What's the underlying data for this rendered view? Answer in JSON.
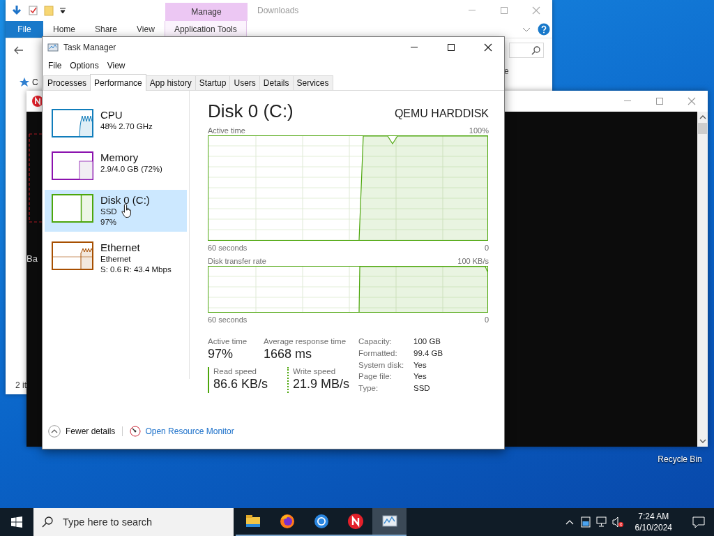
{
  "explorer": {
    "context_tab": "Manage",
    "title": "Downloads",
    "ribbon_tabs": [
      {
        "label": "File",
        "kind": "file"
      },
      {
        "label": "Home",
        "kind": "tab"
      },
      {
        "label": "Share",
        "kind": "tab"
      },
      {
        "label": "View",
        "kind": "tab"
      },
      {
        "label": "Application Tools",
        "kind": "context"
      }
    ],
    "nav_items": [
      "C"
    ],
    "cut_text": "e",
    "status_bar": "2 it"
  },
  "console_window": {
    "text": "Ba"
  },
  "task_manager": {
    "title": "Task Manager",
    "menu": [
      "File",
      "Options",
      "View"
    ],
    "tabs": [
      {
        "label": "Processes",
        "selected": false
      },
      {
        "label": "Performance",
        "selected": true
      },
      {
        "label": "App history",
        "selected": false
      },
      {
        "label": "Startup",
        "selected": false
      },
      {
        "label": "Users",
        "selected": false
      },
      {
        "label": "Details",
        "selected": false
      },
      {
        "label": "Services",
        "selected": false
      }
    ],
    "resources": [
      {
        "kind": "cpu",
        "name": "CPU",
        "details": [
          "48%  2.70 GHz"
        ],
        "color": "#117dbb",
        "selected": false
      },
      {
        "kind": "memory",
        "name": "Memory",
        "details": [
          "2.9/4.0 GB (72%)"
        ],
        "color": "#8b12ae",
        "selected": false
      },
      {
        "kind": "disk",
        "name": "Disk 0 (C:)",
        "details": [
          "SSD",
          "97%"
        ],
        "color": "#4da60c",
        "selected": true
      },
      {
        "kind": "network",
        "name": "Ethernet",
        "details": [
          "Ethernet",
          "S: 0.6 R: 43.4 Mbps"
        ],
        "color": "#a74f01",
        "selected": false
      }
    ],
    "detail": {
      "title": "Disk 0 (C:)",
      "model": "QEMU HARDDISK",
      "graphs": [
        {
          "kind": "active",
          "label": "Active time",
          "max": "100%",
          "span": "60 seconds",
          "min": "0"
        },
        {
          "kind": "transfer",
          "label": "Disk transfer rate",
          "max": "100 KB/s",
          "span": "60 seconds",
          "min": "0"
        }
      ],
      "stats": [
        {
          "label": "Active time",
          "value": "97%"
        },
        {
          "label": "Average response time",
          "value": "1668 ms"
        }
      ],
      "speeds": [
        {
          "kind": "read",
          "label": "Read speed",
          "value": "86.6 KB/s"
        },
        {
          "kind": "write",
          "label": "Write speed",
          "value": "21.9 MB/s"
        }
      ],
      "properties": [
        {
          "key": "Capacity:",
          "value": "100 GB"
        },
        {
          "key": "Formatted:",
          "value": "99.4 GB"
        },
        {
          "key": "System disk:",
          "value": "Yes"
        },
        {
          "key": "Page file:",
          "value": "Yes"
        },
        {
          "key": "Type:",
          "value": "SSD"
        }
      ]
    },
    "footer": {
      "toggle": "Fewer details",
      "link": "Open Resource Monitor"
    }
  },
  "desktop_icons": [
    {
      "label": "Recycle Bin"
    }
  ],
  "taskbar": {
    "search": {
      "placeholder": "Type here to search"
    },
    "apps": [
      {
        "kind": "explorer",
        "selected": false
      },
      {
        "kind": "firefox",
        "selected": false
      },
      {
        "kind": "chrome",
        "selected": false
      },
      {
        "kind": "n-app",
        "selected": false
      },
      {
        "kind": "taskmgr",
        "selected": true
      }
    ],
    "time": "7:24 AM",
    "date": "6/10/2024"
  }
}
